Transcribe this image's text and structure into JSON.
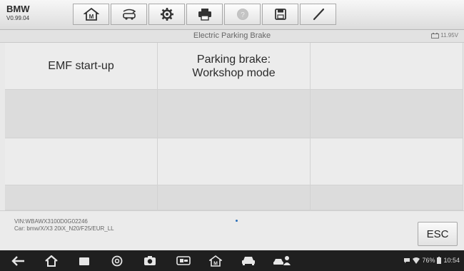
{
  "brand": {
    "name": "BMW",
    "version": "V0.99.04"
  },
  "toolbar": {
    "buttons": [
      "home-icon",
      "vehicle-swap-icon",
      "settings-icon",
      "print-icon",
      "help-icon",
      "save-icon",
      "edit-icon"
    ]
  },
  "titlebar": {
    "title": "Electric Parking Brake",
    "voltage": "11.95V"
  },
  "grid": {
    "row1": [
      "EMF start-up",
      "Parking brake:\nWorkshop mode",
      ""
    ]
  },
  "footer": {
    "vin": "VIN:WBAWX3100D0G02246",
    "car": "Car: bmw/X/X3 20iX_N20/F25/EUR_LL",
    "esc_label": "ESC"
  },
  "statusbar": {
    "battery": "76%",
    "time": "10:54"
  },
  "colors": {
    "toolbar_bg": "#e6e6e6",
    "navbar_bg": "#1f1f1f",
    "cell_light": "#ececec",
    "cell_dark": "#dcdcdc"
  }
}
